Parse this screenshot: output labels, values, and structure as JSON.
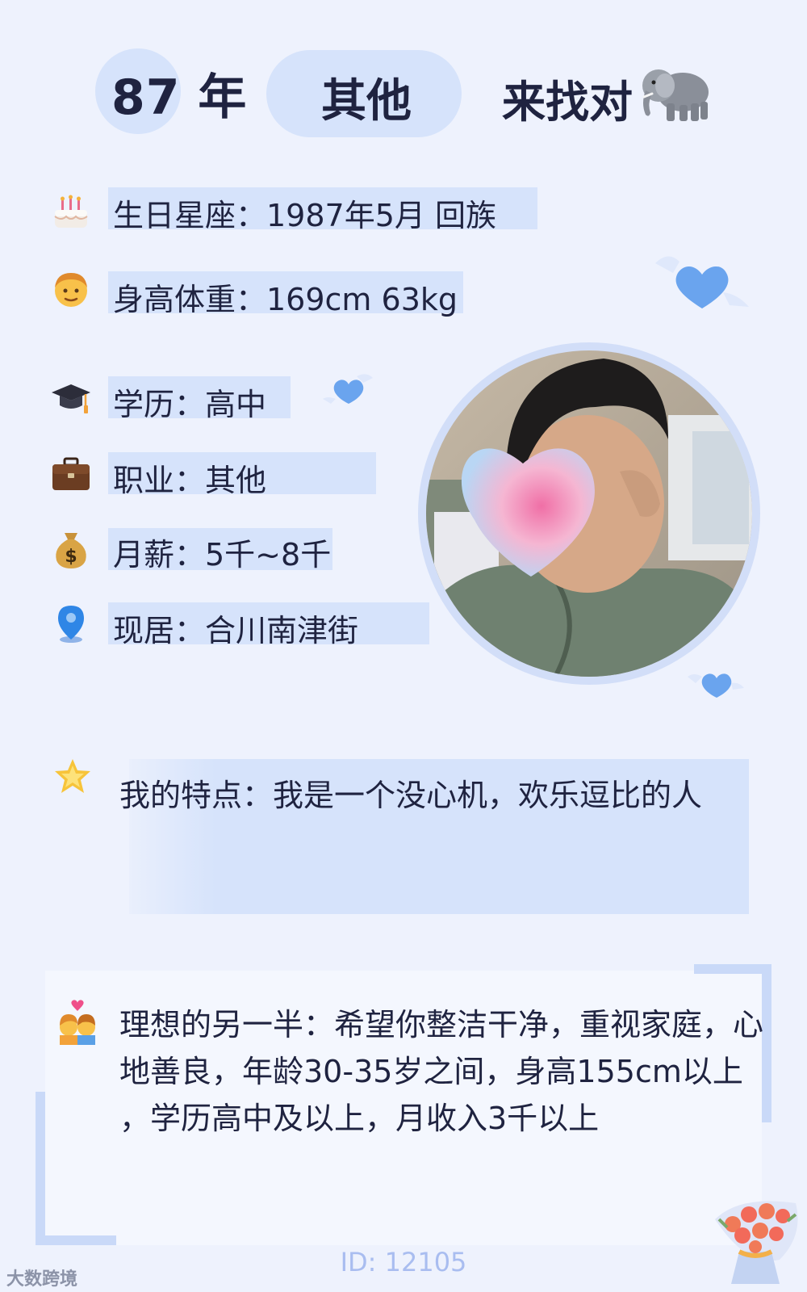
{
  "header": {
    "year": "87 年",
    "occupation": "其他",
    "seeking": "来找对"
  },
  "info": {
    "birthday": "生日星座：1987年5月 回族",
    "height_weight": "身高体重：169cm 63kg",
    "education": "学历：高中",
    "occupation": "职业：其他",
    "salary": "月薪：5千~8千",
    "residence": "现居：合川南津街"
  },
  "traits": "我的特点：我是一个没心机，欢乐逗比的人",
  "ideal": {
    "line1": "理想的另一半：希望你整洁干净，重视家庭，心",
    "line2": "地善良，年龄30-35岁之间，身高155cm以上",
    "line3": "，学历高中及以上，月收入3千以上"
  },
  "footer": {
    "id": "ID: 12105"
  },
  "watermark": "大数跨境",
  "colors": {
    "accent": "#d6e3fb",
    "heart": "#6aa4ee",
    "footer_text": "#a9bdf0",
    "background": "#eef2fd"
  },
  "icons": [
    "elephant-emoji",
    "cake-icon",
    "man-face-icon",
    "graduation-cap-icon",
    "briefcase-icon",
    "money-bag-icon",
    "location-pin-icon",
    "star-icon",
    "couple-icon",
    "heart-icon",
    "flower-bouquet-icon"
  ]
}
